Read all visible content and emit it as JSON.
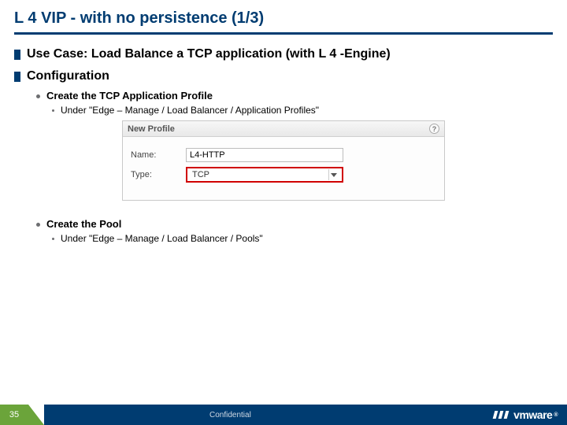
{
  "title": "L 4 VIP - with no persistence (1/3)",
  "bullets": {
    "usecase": "Use Case: Load Balance a TCP application (with L 4 -Engine)",
    "config": "Configuration",
    "create_profile": "Create the TCP Application Profile",
    "profile_path": "Under \"Edge – Manage /  Load Balancer / Application Profiles\"",
    "create_pool": "Create the Pool",
    "pool_path": "Under \"Edge – Manage /  Load Balancer / Pools\""
  },
  "dialog": {
    "header": "New Profile",
    "name_label": "Name:",
    "name_value": "L4-HTTP",
    "type_label": "Type:",
    "type_value": "TCP"
  },
  "footer": {
    "page": "35",
    "confidential": "Confidential",
    "brand": "vmware"
  }
}
